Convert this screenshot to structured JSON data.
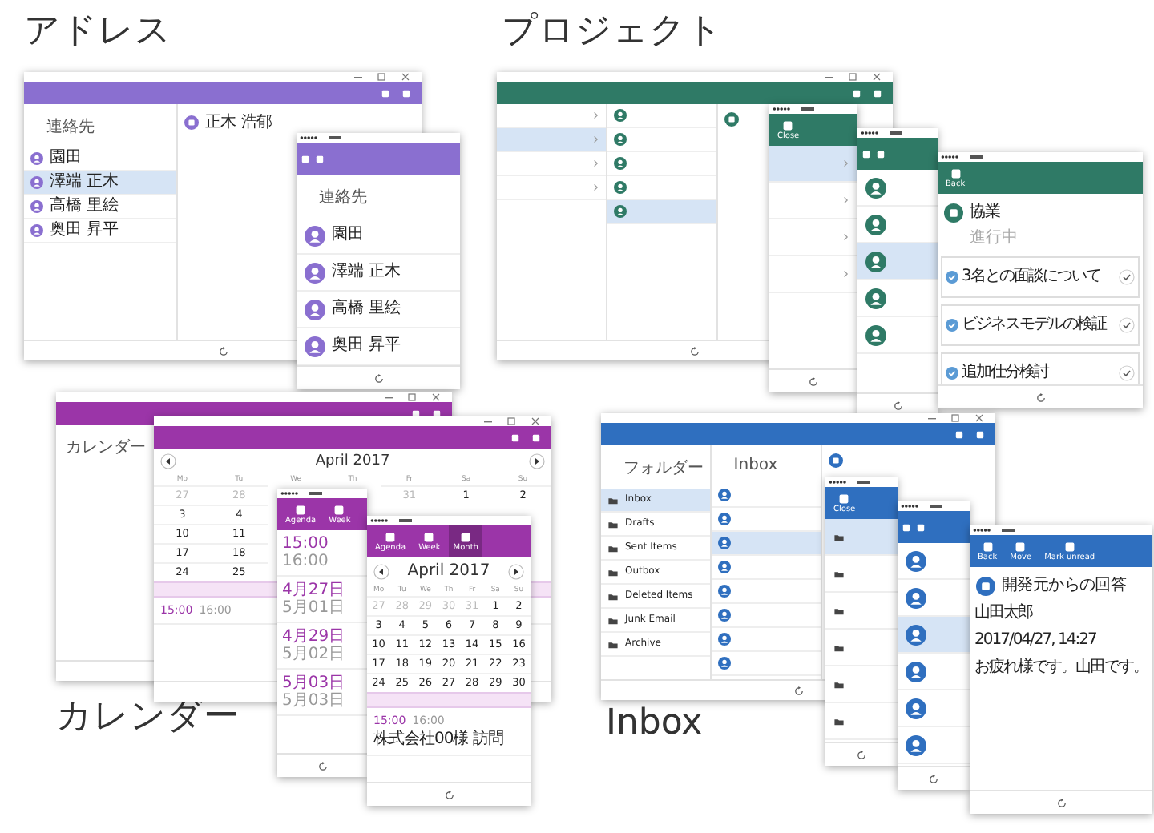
{
  "sections": [
    {
      "title": "アドレス",
      "color": "#8a6fd0",
      "windows": [
        {
          "kind": "tablet",
          "panes": [
            {
              "kind": "avatar-list",
              "title": "連絡先",
              "items": [
                {
                  "text": "園田",
                  "selected": false
                },
                {
                  "text": "澤端 正木",
                  "selected": true
                },
                {
                  "text": "高橋 里絵",
                  "selected": false
                },
                {
                  "text": "奥田 昇平",
                  "selected": false
                }
              ]
            },
            {
              "kind": "detail",
              "title": "正木 浩郁"
            }
          ]
        },
        {
          "kind": "phone",
          "panes": [
            {
              "kind": "avatar-list",
              "title": "連絡先",
              "items": [
                {
                  "text": "園田",
                  "selected": false
                },
                {
                  "text": "澤端 正木",
                  "selected": false
                },
                {
                  "text": "高橋 里絵",
                  "selected": false
                },
                {
                  "text": "奥田 昇平",
                  "selected": false
                }
              ]
            }
          ]
        }
      ]
    },
    {
      "title": "プロジェクト",
      "color": "#2f7a66",
      "windows": [
        {
          "kind": "tablet",
          "panes": [
            {
              "kind": "plain-list",
              "items": [
                {
                  "selected": false
                },
                {
                  "selected": true
                },
                {
                  "selected": false
                },
                {
                  "selected": false
                }
              ]
            },
            {
              "kind": "avatar-list",
              "items": [
                {
                  "selected": false
                },
                {
                  "selected": false
                },
                {
                  "selected": false
                },
                {
                  "selected": false
                },
                {
                  "selected": true
                }
              ]
            },
            {
              "kind": "detail"
            }
          ]
        },
        {
          "kind": "phone",
          "toolbar": [
            {
              "label": "Close"
            }
          ],
          "panes": [
            {
              "kind": "plain-list",
              "items": [
                {
                  "selected": true
                },
                {
                  "selected": false
                },
                {
                  "selected": false
                },
                {
                  "selected": false
                }
              ]
            }
          ]
        },
        {
          "kind": "phone",
          "panes": [
            {
              "kind": "avatar-list",
              "items": [
                {
                  "selected": false
                },
                {
                  "selected": false
                },
                {
                  "selected": true
                },
                {
                  "selected": false
                },
                {
                  "selected": false
                }
              ]
            }
          ]
        },
        {
          "kind": "phone",
          "toolbar": [
            {
              "label": "Back"
            }
          ],
          "panes": [
            {
              "kind": "detail",
              "title": "協業",
              "sub": "進行中",
              "cards": [
                "3名との面談について",
                "ビジネスモデルの検証",
                "追加仕分検討"
              ]
            }
          ]
        }
      ]
    },
    {
      "title": "カレンダー",
      "color": "#9b35a8",
      "windows": [
        {
          "kind": "tablet",
          "panes": [
            {
              "kind": "agenda",
              "title": "カレンダー"
            }
          ]
        },
        {
          "kind": "tablet",
          "panes": [
            {
              "kind": "month",
              "title": "April 2017",
              "weekdays": [
                "Mo",
                "Tu",
                "We",
                "Th",
                "Fr",
                "Sa",
                "Su"
              ],
              "weeks": [
                [
                  {
                    "text": "27",
                    "muted": true
                  },
                  {
                    "text": "28",
                    "muted": true
                  },
                  {
                    "text": "31",
                    "muted": true
                  },
                  {
                    "text": "1",
                    "muted": false
                  },
                  {
                    "text": "2",
                    "muted": false
                  }
                ],
                [
                  {
                    "text": "3",
                    "muted": false
                  },
                  {
                    "text": "4",
                    "muted": false
                  }
                ],
                [
                  {
                    "text": "10",
                    "muted": false
                  },
                  {
                    "text": "11",
                    "muted": false
                  }
                ],
                [
                  {
                    "text": "17",
                    "muted": false
                  },
                  {
                    "text": "18",
                    "muted": false
                  }
                ],
                [
                  {
                    "text": "24",
                    "muted": false
                  },
                  {
                    "text": "25",
                    "muted": false
                  }
                ]
              ],
              "events": [
                {
                  "time": "15:00",
                  "end": "16:00"
                }
              ]
            }
          ]
        },
        {
          "kind": "phone",
          "toolbar": [
            {
              "label": "Agenda",
              "selected": false
            },
            {
              "label": "Week",
              "selected": false
            }
          ],
          "panes": [
            {
              "kind": "agenda",
              "items": [
                {
                  "time": "15:00",
                  "end": "16:00"
                },
                {
                  "time": "4月27日",
                  "end": "5月01日"
                },
                {
                  "time": "4月29日",
                  "end": "5月02日"
                },
                {
                  "time": "5月03日",
                  "end": "5月03日"
                }
              ]
            }
          ]
        },
        {
          "kind": "phone",
          "toolbar": [
            {
              "label": "Agenda",
              "selected": false
            },
            {
              "label": "Week",
              "selected": false
            },
            {
              "label": "Month",
              "selected": true
            }
          ],
          "panes": [
            {
              "kind": "month",
              "title": "April 2017",
              "weekdays": [
                "Mo",
                "Tu",
                "We",
                "Th",
                "Fr",
                "Sa",
                "Su"
              ],
              "weeks": [
                [
                  {
                    "text": "27",
                    "muted": true
                  },
                  {
                    "text": "28",
                    "muted": true
                  },
                  {
                    "text": "29",
                    "muted": true
                  },
                  {
                    "text": "30",
                    "muted": true
                  },
                  {
                    "text": "31",
                    "muted": true
                  },
                  {
                    "text": "1",
                    "muted": false
                  },
                  {
                    "text": "2",
                    "muted": false
                  }
                ],
                [
                  {
                    "text": "3",
                    "muted": false
                  },
                  {
                    "text": "4",
                    "muted": false
                  },
                  {
                    "text": "5",
                    "muted": false
                  },
                  {
                    "text": "6",
                    "muted": false
                  },
                  {
                    "text": "7",
                    "muted": false
                  },
                  {
                    "text": "8",
                    "muted": false
                  },
                  {
                    "text": "9",
                    "muted": false
                  }
                ],
                [
                  {
                    "text": "10",
                    "muted": false
                  },
                  {
                    "text": "11",
                    "muted": false
                  },
                  {
                    "text": "12",
                    "muted": false
                  },
                  {
                    "text": "13",
                    "muted": false
                  },
                  {
                    "text": "14",
                    "muted": false
                  },
                  {
                    "text": "15",
                    "muted": false
                  },
                  {
                    "text": "16",
                    "muted": false
                  }
                ],
                [
                  {
                    "text": "17",
                    "muted": false
                  },
                  {
                    "text": "18",
                    "muted": false
                  },
                  {
                    "text": "19",
                    "muted": false
                  },
                  {
                    "text": "20",
                    "muted": false
                  },
                  {
                    "text": "21",
                    "muted": false
                  },
                  {
                    "text": "22",
                    "muted": false
                  },
                  {
                    "text": "23",
                    "muted": false
                  }
                ],
                [
                  {
                    "text": "24",
                    "muted": false
                  },
                  {
                    "text": "25",
                    "muted": false
                  },
                  {
                    "text": "26",
                    "muted": false
                  },
                  {
                    "text": "27",
                    "muted": false
                  },
                  {
                    "text": "28",
                    "muted": false
                  },
                  {
                    "text": "29",
                    "muted": false
                  },
                  {
                    "text": "30",
                    "muted": false
                  }
                ]
              ],
              "events": [
                {
                  "time": "15:00",
                  "end": "16:00",
                  "text": "株式会社00様 訪問"
                }
              ]
            }
          ]
        }
      ]
    },
    {
      "title": "Inbox",
      "color": "#2f6fbf",
      "windows": [
        {
          "kind": "tablet",
          "panes": [
            {
              "kind": "folder-list",
              "title": "フォルダー",
              "items": [
                {
                  "text": "Inbox",
                  "selected": true
                },
                {
                  "text": "Drafts",
                  "selected": false
                },
                {
                  "text": "Sent Items",
                  "selected": false
                },
                {
                  "text": "Outbox",
                  "selected": false
                },
                {
                  "text": "Deleted Items",
                  "selected": false
                },
                {
                  "text": "Junk Email",
                  "selected": false
                },
                {
                  "text": "Archive",
                  "selected": false
                }
              ]
            },
            {
              "kind": "avatar-list",
              "title": "Inbox",
              "items": [
                {
                  "selected": false
                },
                {
                  "selected": false
                },
                {
                  "selected": true
                },
                {
                  "selected": false
                },
                {
                  "selected": false
                },
                {
                  "selected": false
                },
                {
                  "selected": false
                },
                {
                  "selected": false
                }
              ]
            },
            {
              "kind": "detail"
            }
          ]
        },
        {
          "kind": "phone",
          "toolbar": [
            {
              "label": "Close"
            }
          ],
          "panes": [
            {
              "kind": "folder-list",
              "items": [
                {
                  "selected": true
                },
                {
                  "selected": false
                },
                {
                  "selected": false
                },
                {
                  "selected": false
                },
                {
                  "selected": false
                },
                {
                  "selected": false
                }
              ]
            }
          ]
        },
        {
          "kind": "phone",
          "panes": [
            {
              "kind": "avatar-list",
              "items": [
                {
                  "selected": false
                },
                {
                  "selected": false
                },
                {
                  "selected": true
                },
                {
                  "selected": false
                },
                {
                  "selected": false
                },
                {
                  "selected": false
                }
              ]
            }
          ]
        },
        {
          "kind": "phone",
          "toolbar": [
            {
              "label": "Back"
            },
            {
              "label": "Move"
            },
            {
              "label": "Mark unread"
            }
          ],
          "panes": [
            {
              "kind": "detail",
              "title": "開発元からの回答",
              "lines": [
                "山田太郎",
                "2017/04/27, 14:27",
                "お疲れ様です。山田です。"
              ]
            }
          ]
        }
      ]
    }
  ]
}
